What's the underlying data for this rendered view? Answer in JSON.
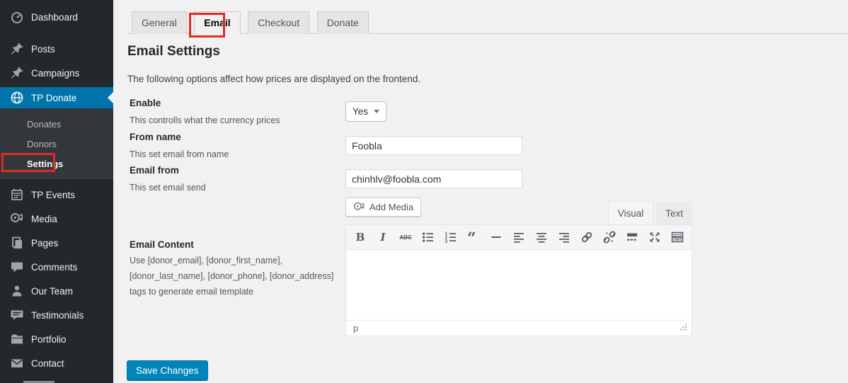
{
  "sidebar": {
    "items": [
      {
        "label": "Dashboard",
        "icon": "dashboard-icon"
      },
      {
        "label": "Posts",
        "icon": "pin-icon"
      },
      {
        "label": "Campaigns",
        "icon": "pin-icon"
      },
      {
        "label": "TP Donate",
        "icon": "globe-icon",
        "active": true
      },
      {
        "label": "TP Events",
        "icon": "calendar-icon"
      },
      {
        "label": "Media",
        "icon": "media-icon"
      },
      {
        "label": "Pages",
        "icon": "pages-icon"
      },
      {
        "label": "Comments",
        "icon": "comment-icon"
      },
      {
        "label": "Our Team",
        "icon": "user-icon"
      },
      {
        "label": "Testimonials",
        "icon": "testimonial-icon"
      },
      {
        "label": "Portfolio",
        "icon": "portfolio-icon"
      },
      {
        "label": "Contact",
        "icon": "envelope-icon"
      }
    ],
    "submenu": [
      {
        "label": "Donates"
      },
      {
        "label": "Donors"
      },
      {
        "label": "Settings",
        "current": true,
        "annotated": true
      }
    ]
  },
  "tabs": {
    "items": [
      {
        "label": "General"
      },
      {
        "label": "Email",
        "active": true,
        "annotated": true
      },
      {
        "label": "Checkout"
      },
      {
        "label": "Donate"
      }
    ]
  },
  "page": {
    "title": "Email Settings",
    "description": "The following options affect how prices are displayed on the frontend."
  },
  "fields": {
    "enable": {
      "label": "Enable",
      "help": "This controlls what the currency prices",
      "value": "Yes"
    },
    "from_name": {
      "label": "From name",
      "help": "This set email from name",
      "value": "Foobla"
    },
    "email_from": {
      "label": "Email from",
      "help": "This set email send",
      "value": "chinhlv@foobla.com"
    },
    "email_content": {
      "label": "Email Content",
      "help": "Use [donor_email], [donor_first_name], [donor_last_name], [donor_phone], [donor_address] tags to generate email template"
    }
  },
  "editor": {
    "add_media_label": "Add Media",
    "visual_tab": "Visual",
    "text_tab": "Text",
    "status_path": "p",
    "bold_glyph": "B",
    "italic_glyph": "I",
    "strike_glyph": "ABC",
    "quote_glyph": "“",
    "ol_digits": [
      "1",
      "2",
      "3"
    ],
    "toolbar_icons": [
      "bold",
      "italic",
      "strikethrough",
      "bulleted-list",
      "numbered-list",
      "blockquote",
      "horizontal-rule",
      "align-left",
      "align-center",
      "align-right",
      "link",
      "unlink",
      "more-tag",
      "fullscreen",
      "toolbar-toggle"
    ]
  },
  "footer": {
    "save_label": "Save Changes"
  },
  "colors": {
    "sidebar_bg": "#23282d",
    "submenu_bg": "#32373c",
    "active_menu_blue": "#0073aa",
    "content_bg": "#f1f1f1",
    "save_button_blue": "#0085ba",
    "annotation_red": "#dd2c23"
  }
}
